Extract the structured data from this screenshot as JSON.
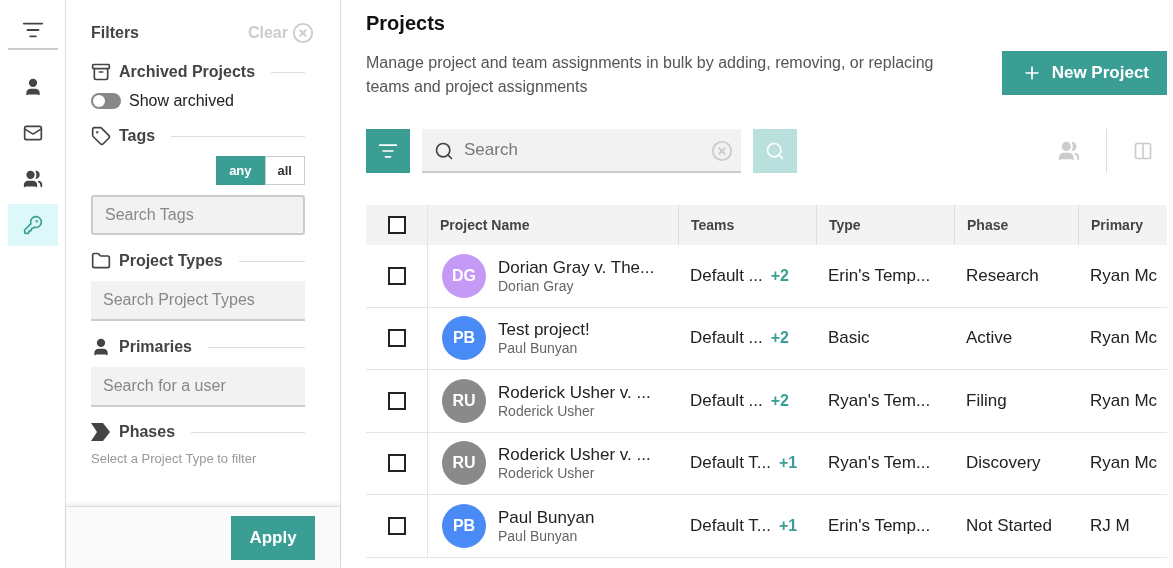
{
  "rail": {
    "items": [
      {
        "kind": "user",
        "selected": false
      },
      {
        "kind": "mail",
        "selected": false
      },
      {
        "kind": "team",
        "selected": false
      },
      {
        "kind": "key",
        "selected": true
      }
    ]
  },
  "filters": {
    "title": "Filters",
    "clear": "Clear",
    "sections": [
      {
        "kind": "archived",
        "title": "Archived Projects",
        "toggle": {
          "label": "Show archived",
          "on": false
        }
      },
      {
        "kind": "tags",
        "title": "Tags",
        "match": [
          {
            "label": "any",
            "selected": true
          },
          {
            "label": "all",
            "selected": false
          }
        ],
        "placeholder": "Search Tags"
      },
      {
        "kind": "types",
        "title": "Project Types",
        "placeholder": "Search Project Types"
      },
      {
        "kind": "primaries",
        "title": "Primaries",
        "placeholder": "Search for a user"
      },
      {
        "kind": "phases",
        "title": "Phases",
        "note": "Select a Project Type to filter"
      }
    ],
    "apply": "Apply"
  },
  "main": {
    "title": "Projects",
    "description": "Manage project and team assignments in bulk by adding, removing, or replacing teams and project assignments",
    "new_button": "New Project",
    "search": {
      "placeholder": "Search"
    },
    "table": {
      "select_all_checked": false,
      "columns": [
        "Project Name",
        "Teams",
        "Type",
        "Phase",
        "Primary"
      ],
      "rows": [
        {
          "initials": "DG",
          "color": "#c59af7",
          "name": "Dorian Gray v. The...",
          "client": "Dorian Gray",
          "team": "Default ...",
          "extra": "+2",
          "type": "Erin's Temp...",
          "phase": "Research",
          "primary": "Ryan Mc",
          "checked": false
        },
        {
          "initials": "PB",
          "color": "#4a8af7",
          "name": "Test project!",
          "client": "Paul Bunyan",
          "team": "Default ...",
          "extra": "+2",
          "type": "Basic",
          "phase": "Active",
          "primary": "Ryan Mc",
          "checked": false
        },
        {
          "initials": "RU",
          "color": "#8a8a8a",
          "name": "Roderick Usher v. ...",
          "client": "Roderick Usher",
          "team": "Default ...",
          "extra": "+2",
          "type": "Ryan's Tem...",
          "phase": "Filing",
          "primary": "Ryan Mc",
          "checked": false
        },
        {
          "initials": "RU",
          "color": "#8a8a8a",
          "name": "Roderick Usher v. ...",
          "client": "Roderick Usher",
          "team": "Default T...",
          "extra": "+1",
          "type": "Ryan's Tem...",
          "phase": "Discovery",
          "primary": "Ryan Mc",
          "checked": false
        },
        {
          "initials": "PB",
          "color": "#4a8af7",
          "name": "Paul Bunyan",
          "client": "Paul Bunyan",
          "team": "Default T...",
          "extra": "+1",
          "type": "Erin's Temp...",
          "phase": "Not Started",
          "primary": "RJ M",
          "checked": false
        }
      ]
    }
  }
}
